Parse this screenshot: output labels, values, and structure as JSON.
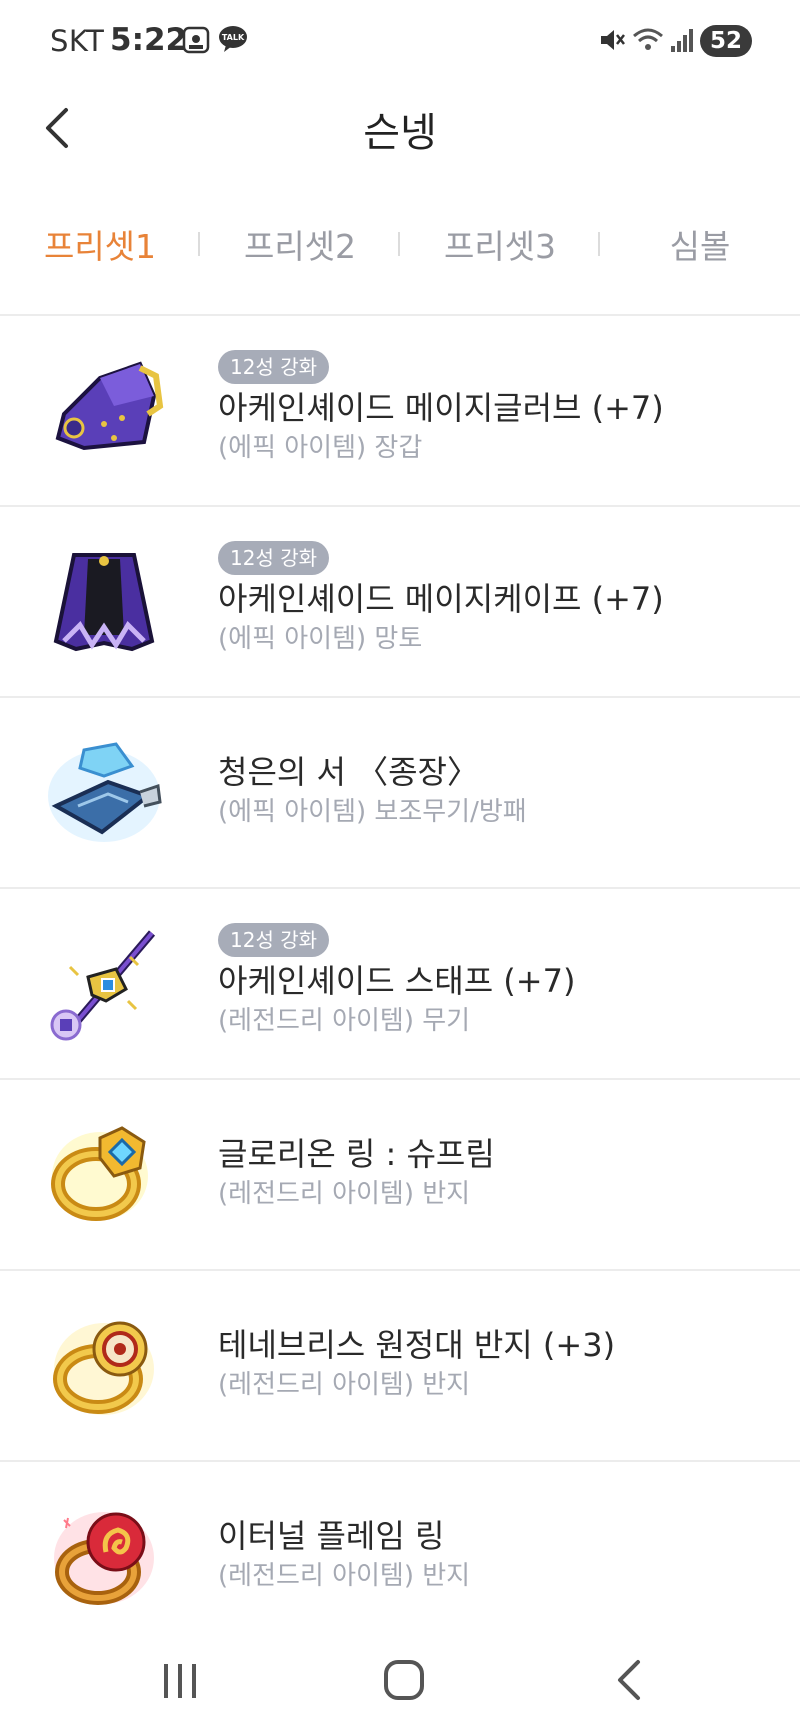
{
  "status_bar": {
    "carrier": "SKT",
    "time": "5:22",
    "notification_icons": [
      "screenshot-icon",
      "kakaotalk-icon"
    ],
    "talk_label": "TALK",
    "system_icons": [
      "mute-icon",
      "wifi-icon",
      "signal-icon"
    ],
    "battery": "52"
  },
  "header": {
    "title": "슨넹"
  },
  "tabs": [
    {
      "label": "프리셋1",
      "active": true
    },
    {
      "label": "프리셋2",
      "active": false
    },
    {
      "label": "프리셋3",
      "active": false
    },
    {
      "label": "심볼",
      "active": false
    }
  ],
  "colors": {
    "accent": "#e88338",
    "badge": "#a7acb8",
    "muted_text": "#a5a9b3"
  },
  "items": [
    {
      "badge": "12성 강화",
      "name": "아케인셰이드 메이지글러브 (+7)",
      "sub": "(에픽 아이템) 장갑",
      "icon": "glove-icon"
    },
    {
      "badge": "12성 강화",
      "name": "아케인셰이드 메이지케이프 (+7)",
      "sub": "(에픽 아이템) 망토",
      "icon": "cape-icon"
    },
    {
      "badge": "",
      "name": "청은의 서 〈종장〉",
      "sub": "(에픽 아이템) 보조무기/방패",
      "icon": "book-icon"
    },
    {
      "badge": "12성 강화",
      "name": "아케인셰이드 스태프 (+7)",
      "sub": "(레전드리 아이템) 무기",
      "icon": "staff-icon"
    },
    {
      "badge": "",
      "name": "글로리온 링 : 슈프림",
      "sub": "(레전드리 아이템) 반지",
      "icon": "ring-icon"
    },
    {
      "badge": "",
      "name": "테네브리스 원정대 반지 (+3)",
      "sub": "(레전드리 아이템) 반지",
      "icon": "ring-icon"
    },
    {
      "badge": "",
      "name": "이터널 플레임 링",
      "sub": "(레전드리 아이템) 반지",
      "icon": "ring-icon"
    }
  ],
  "nav": [
    "recent-apps-icon",
    "home-icon",
    "back-icon"
  ]
}
